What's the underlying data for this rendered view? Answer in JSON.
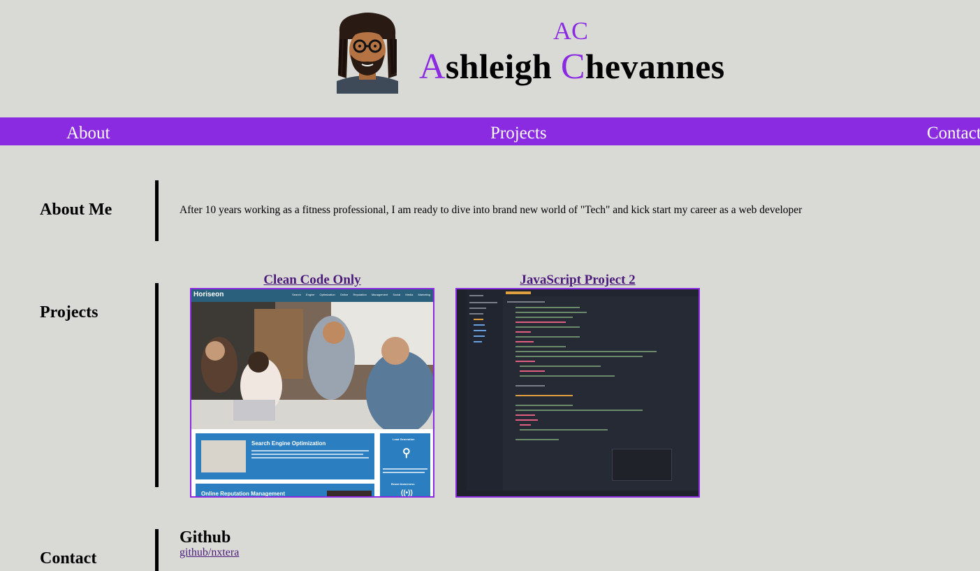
{
  "header": {
    "monogram": "AC",
    "name_first_initial": "A",
    "name_first_rest": "shleigh ",
    "name_last_initial": "C",
    "name_last_rest": "hevannes",
    "avatar": "man-with-locs-and-glasses-avatar",
    "accent_color": "#8a2be2"
  },
  "nav": {
    "about": "About",
    "projects": "Projects",
    "contact": "Contact"
  },
  "about": {
    "title": "About Me",
    "text": "After 10 years working as a fitness professional, I am ready to dive into brand new world of \"Tech\" and kick start my career as a web developer"
  },
  "projects": {
    "title": "Projects",
    "items": [
      {
        "title": "Clean Code Only",
        "screenshot": {
          "logo": "Horiseon",
          "nav": "Search Engine Optimization  Online Reputation Management  Social Media Marketing",
          "card1": "Search Engine Optimization",
          "card2": "Online Reputation Management",
          "side1": "Lead Generation",
          "side2": "Brand Awareness"
        }
      },
      {
        "title": "JavaScript Project 2",
        "screenshot": {
          "editor": "code-editor-screenshot"
        }
      }
    ]
  },
  "contact": {
    "title": "Contact",
    "github_heading": "Github",
    "github_link": "github/nxtera"
  }
}
